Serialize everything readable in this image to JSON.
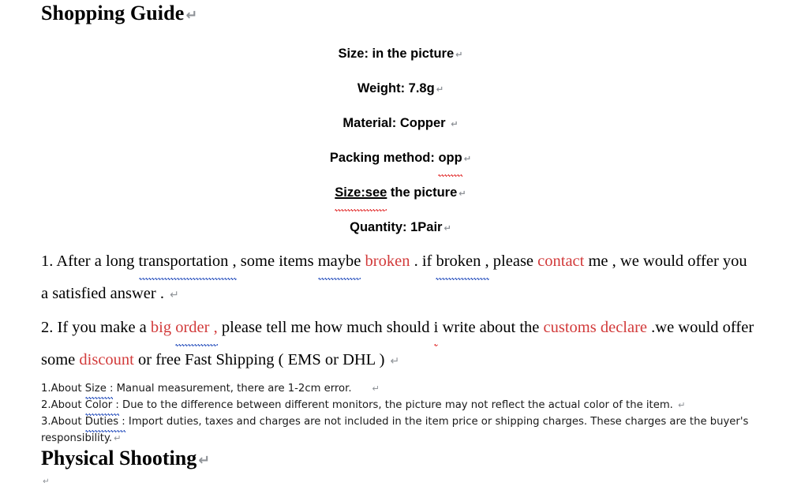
{
  "document": {
    "title": "Shopping Guide",
    "section_title": "Physical Shooting",
    "return_mark": "↵",
    "colors": {
      "highlight_red": "#d23b3b",
      "spellcheck_red": "#e12d2d",
      "grammarcheck_blue": "#2a52be",
      "text_black": "#000000",
      "pilcrow_grey": "#8f9398",
      "background": "#ffffff"
    }
  },
  "specs": [
    {
      "label": "Size:",
      "value": "in the picture"
    },
    {
      "label": "Weight:",
      "value": "7.8g"
    },
    {
      "label": "Material:",
      "value": "Copper "
    },
    {
      "label": "Packing method:",
      "value": "opp"
    },
    {
      "label": "Size:see",
      "value": "the picture"
    },
    {
      "label": "Quantity:",
      "value": "1Pair"
    }
  ],
  "spec_lines": {
    "line1": "Size: in the picture",
    "line2": "Weight: 7.8g",
    "line3": "Material: Copper ",
    "line4_a": "Packing method: ",
    "line4_b": "opp",
    "line5_a": "Size:see",
    "line5_b": " the picture",
    "line6": "Quantity: 1Pair"
  },
  "paragraph1": {
    "number": "1. ",
    "seg_a": "After a long ",
    "seg_b": "transportation ,",
    "seg_c": " some items ",
    "seg_d": "maybe",
    "seg_e": " ",
    "seg_f": "broken",
    "seg_g": " . if ",
    "seg_h": "broken ,",
    "seg_i": " please ",
    "seg_j": "contact",
    "seg_k": " me , we would offer you",
    "line2": "a satisfied answer . "
  },
  "paragraph2": {
    "number": "2. ",
    "seg_a": "If you make a ",
    "seg_b": "big ",
    "seg_c": "order ,",
    "seg_d": " please tell me how much should ",
    "seg_e": "i",
    "seg_f": " write about the ",
    "seg_g": "customs declare",
    "seg_h": " .we would offer",
    "line2_a": "some ",
    "line2_b": "discount",
    "line2_c": " or free Fast Shipping ( EMS or DHL ) "
  },
  "notes": [
    {
      "number": "1.About ",
      "term": "Size :",
      "text": " Manual measurement, there are 1-2cm error.",
      "has_return": true
    },
    {
      "number": "2.About ",
      "term": "Color :",
      "text": " Due to the difference between different monitors, the picture may not reflect the actual color of the item. ",
      "has_return": true
    },
    {
      "number": "3.About ",
      "term": "Duties :",
      "text": " Import duties, taxes and charges are not included in the item price or shipping charges. These charges are the buyer's responsibility.",
      "has_return": true
    }
  ]
}
